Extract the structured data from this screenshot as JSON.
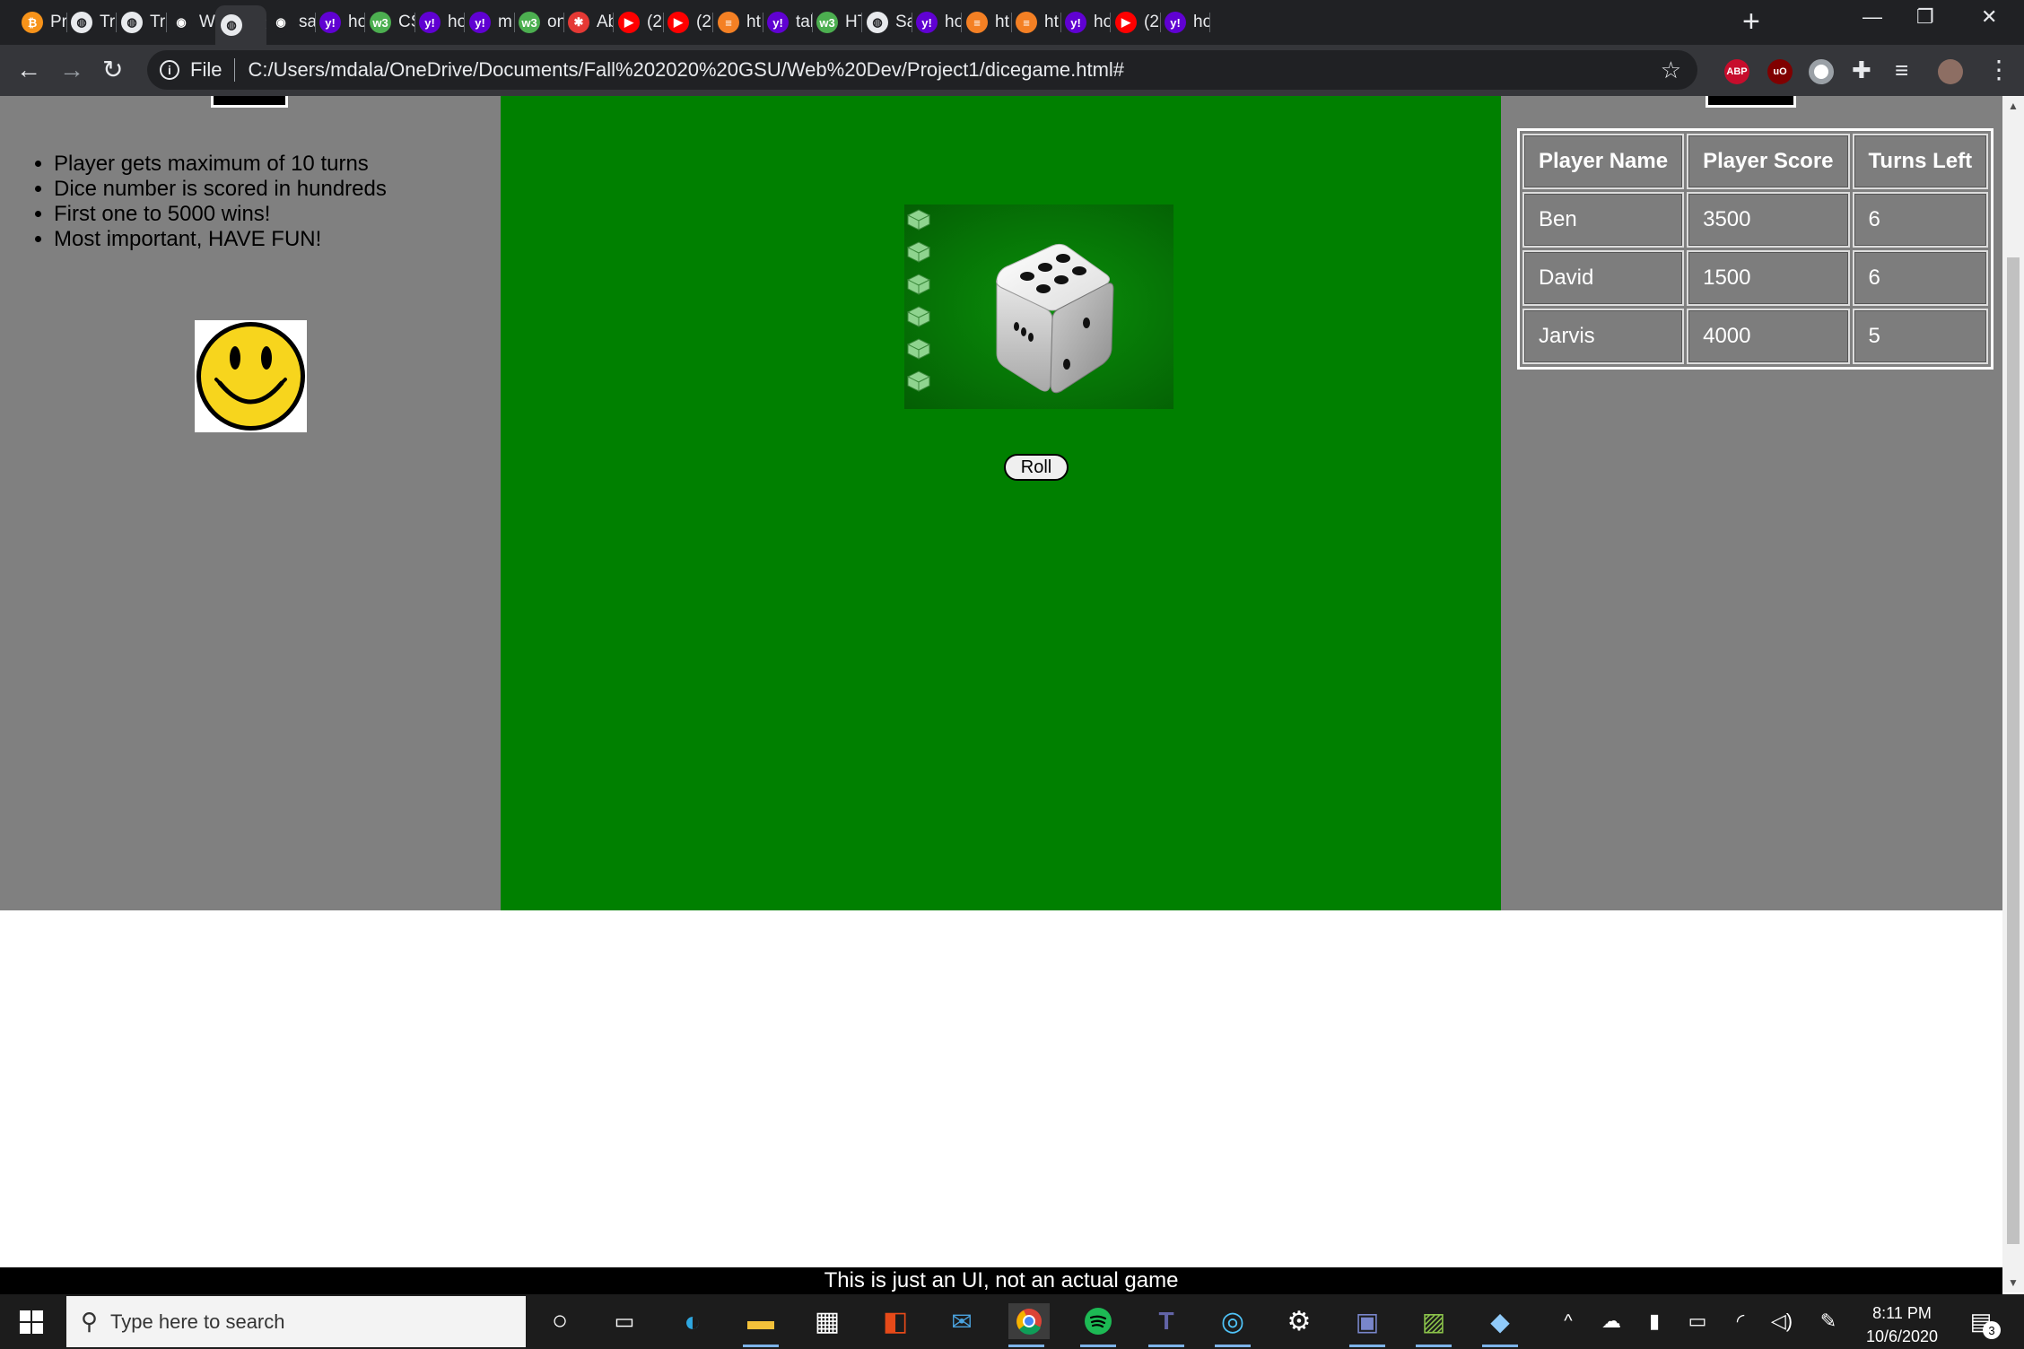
{
  "browser": {
    "tabs": [
      {
        "title": "Pr",
        "icon": "bitcoin-icon",
        "color": "#f7931a",
        "glyph": "₿"
      },
      {
        "title": "Tra",
        "icon": "globe-icon",
        "color": "#e8eaed",
        "glyph": "◍"
      },
      {
        "title": "Tra",
        "icon": "globe-icon",
        "color": "#e8eaed",
        "glyph": "◍"
      },
      {
        "title": "We",
        "icon": "github-icon",
        "color": "#202124",
        "glyph": "◉"
      },
      {
        "title": "",
        "icon": "globe-icon",
        "color": "#e8eaed",
        "glyph": "◍",
        "active": true
      },
      {
        "title": "sa",
        "icon": "github-icon",
        "color": "#202124",
        "glyph": "◉"
      },
      {
        "title": "ho",
        "icon": "yahoo-icon",
        "color": "#6001d2",
        "glyph": "y!"
      },
      {
        "title": "CS",
        "icon": "w3schools-icon",
        "color": "#4caf50",
        "glyph": "w3"
      },
      {
        "title": "ho",
        "icon": "yahoo-icon",
        "color": "#6001d2",
        "glyph": "y!"
      },
      {
        "title": "m",
        "icon": "yahoo-icon",
        "color": "#6001d2",
        "glyph": "y!"
      },
      {
        "title": "on",
        "icon": "w3schools-icon",
        "color": "#4caf50",
        "glyph": "w3"
      },
      {
        "title": "Ab",
        "icon": "asterisk-icon",
        "color": "#e53935",
        "glyph": "✱"
      },
      {
        "title": "(2",
        "icon": "youtube-icon",
        "color": "#ff0000",
        "glyph": "▶"
      },
      {
        "title": "(2",
        "icon": "youtube-icon",
        "color": "#ff0000",
        "glyph": "▶"
      },
      {
        "title": "ht",
        "icon": "stackoverflow-icon",
        "color": "#f48024",
        "glyph": "≡"
      },
      {
        "title": "tal",
        "icon": "yahoo-icon",
        "color": "#6001d2",
        "glyph": "y!"
      },
      {
        "title": "HT",
        "icon": "w3schools-icon",
        "color": "#4caf50",
        "glyph": "w3"
      },
      {
        "title": "Sa",
        "icon": "globe-icon",
        "color": "#e8eaed",
        "glyph": "◍"
      },
      {
        "title": "ho",
        "icon": "yahoo-icon",
        "color": "#6001d2",
        "glyph": "y!"
      },
      {
        "title": "ht",
        "icon": "stackoverflow-icon",
        "color": "#f48024",
        "glyph": "≡"
      },
      {
        "title": "ht",
        "icon": "stackoverflow-icon",
        "color": "#f48024",
        "glyph": "≡"
      },
      {
        "title": "ho",
        "icon": "yahoo-icon",
        "color": "#6001d2",
        "glyph": "y!"
      },
      {
        "title": "(2",
        "icon": "youtube-icon",
        "color": "#ff0000",
        "glyph": "▶"
      },
      {
        "title": "ho",
        "icon": "yahoo-icon",
        "color": "#6001d2",
        "glyph": "y!"
      }
    ],
    "address": {
      "scheme_label": "File",
      "url": "C:/Users/mdala/OneDrive/Documents/Fall%202020%20GSU/Web%20Dev/Project1/dicegame.html#"
    },
    "extensions": [
      {
        "name": "adblock-plus-icon",
        "label": "ABP",
        "color": "#c70d2c"
      },
      {
        "name": "ublock-origin-icon",
        "label": "uO",
        "color": "#800000"
      },
      {
        "name": "record-extension-icon",
        "label": "",
        "color": "#9aa0a6"
      }
    ]
  },
  "page": {
    "rules": [
      "Player gets maximum of 10 turns",
      "Dice number is scored in hundreds",
      "First one to 5000 wins!",
      "Most important, HAVE FUN!"
    ],
    "roll_button": "Roll",
    "scoreboard": {
      "headers": [
        "Player Name",
        "Player Score",
        "Turns Left"
      ],
      "rows": [
        [
          "Ben",
          "3500",
          "6"
        ],
        [
          "David",
          "1500",
          "6"
        ],
        [
          "Jarvis",
          "4000",
          "5"
        ]
      ]
    },
    "footer": "This is just an UI, not an actual game",
    "colors": {
      "game_area": "#008000",
      "side_panels": "#808080"
    }
  },
  "taskbar": {
    "search_placeholder": "Type here to search",
    "time": "8:11 PM",
    "date": "10/6/2020",
    "notification_count": "3"
  }
}
